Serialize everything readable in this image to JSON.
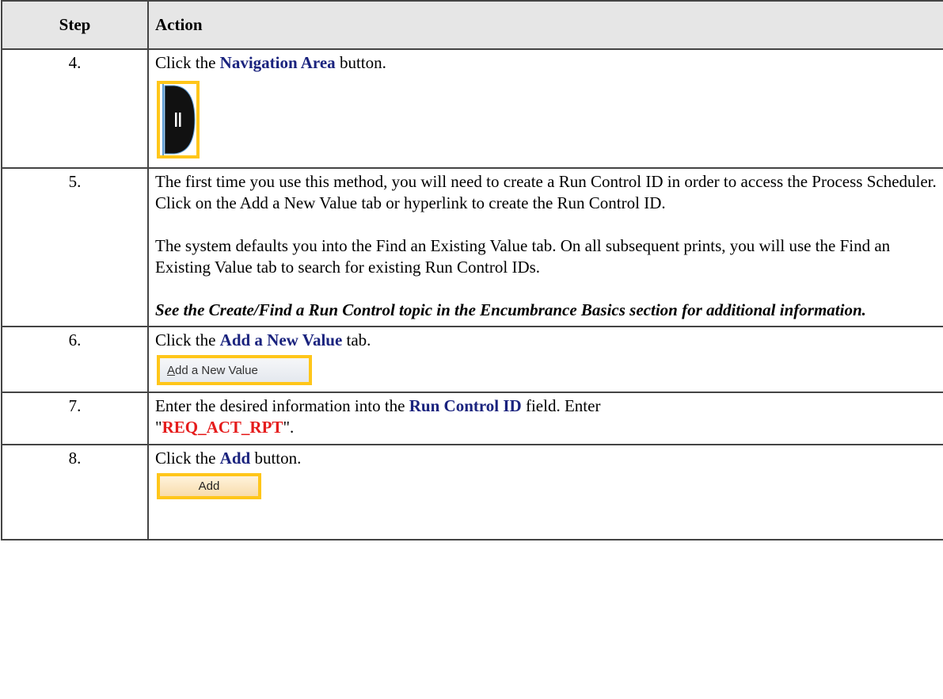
{
  "header": {
    "step": "Step",
    "action": "Action"
  },
  "rows": [
    {
      "step": "4.",
      "before": "Click the ",
      "highlight": "Navigation Area",
      "after": " button."
    },
    {
      "step": "5.",
      "para1": "The first time you use this method, you will need to create a Run Control ID in order to access the Process Scheduler. Click on the Add a New Value tab or hyperlink to create the Run Control ID.",
      "para2": "The system defaults you into the Find an Existing Value tab. On all subsequent prints, you will use the Find an Existing Value tab to search for existing Run Control IDs.",
      "note": "See the Create/Find a Run Control topic in the Encumbrance Basics section for additional information."
    },
    {
      "step": "6.",
      "before": "Click the ",
      "highlight": "Add a New Value",
      "after": " tab.",
      "image_label_underlined": "A",
      "image_label_rest": "dd a New Value"
    },
    {
      "step": "7.",
      "before": "Enter the desired information into the ",
      "highlight": "Run Control ID",
      "after": " field. Enter",
      "quote_open": "\"",
      "value": "REQ_ACT_RPT",
      "quote_close": "\"."
    },
    {
      "step": "8.",
      "before": "Click the ",
      "highlight": "Add",
      "after": " button.",
      "image_label": "Add"
    }
  ],
  "colors": {
    "highlight": "#1a237e",
    "value": "#e51c1c",
    "frame": "#ffc61a"
  }
}
